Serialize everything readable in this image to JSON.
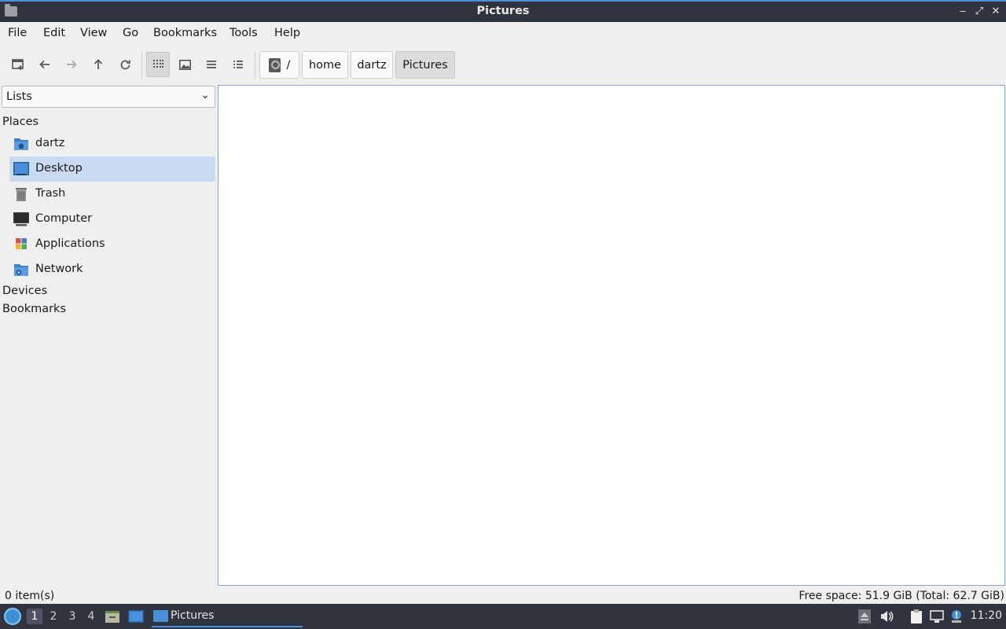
{
  "window": {
    "title": "Pictures",
    "controls": {
      "minimize": "‒",
      "maximize": "⤢",
      "close": "✕"
    }
  },
  "menu": [
    "File",
    "Edit",
    "View",
    "Go",
    "Bookmarks",
    "Tools",
    "Help"
  ],
  "toolbar": {
    "buttons": [
      "new-tab-icon",
      "back-arrow-icon",
      "forward-arrow-icon",
      "up-arrow-icon",
      "reload-icon",
      "icon-view-icon",
      "thumbnail-view-icon",
      "compact-view-icon",
      "detailed-list-icon"
    ],
    "active_view": "icon-view"
  },
  "breadcrumbs": [
    "/",
    "home",
    "dartz",
    "Pictures"
  ],
  "sidebar": {
    "combo_value": "Lists",
    "places_header": "Places",
    "places": [
      {
        "label": "dartz",
        "icon": "home-folder-icon"
      },
      {
        "label": "Desktop",
        "icon": "desktop-icon",
        "selected": true
      },
      {
        "label": "Trash",
        "icon": "trash-icon"
      },
      {
        "label": "Computer",
        "icon": "computer-icon"
      },
      {
        "label": "Applications",
        "icon": "applications-icon"
      },
      {
        "label": "Network",
        "icon": "network-folder-icon"
      }
    ],
    "devices_header": "Devices",
    "bookmarks_header": "Bookmarks"
  },
  "status": {
    "left": "0 item(s)",
    "right": "Free space: 51.9 GiB (Total: 62.7 GiB)"
  },
  "taskbar": {
    "workspaces": [
      "1",
      "2",
      "3",
      "4"
    ],
    "active_workspace": "1",
    "task_label": "Pictures",
    "clock": "11:20"
  },
  "colors": {
    "titlebar_bg": "#2f343f",
    "accent": "#4a90d9",
    "selection": "#c9dbf0",
    "window_bg": "#efefef"
  }
}
